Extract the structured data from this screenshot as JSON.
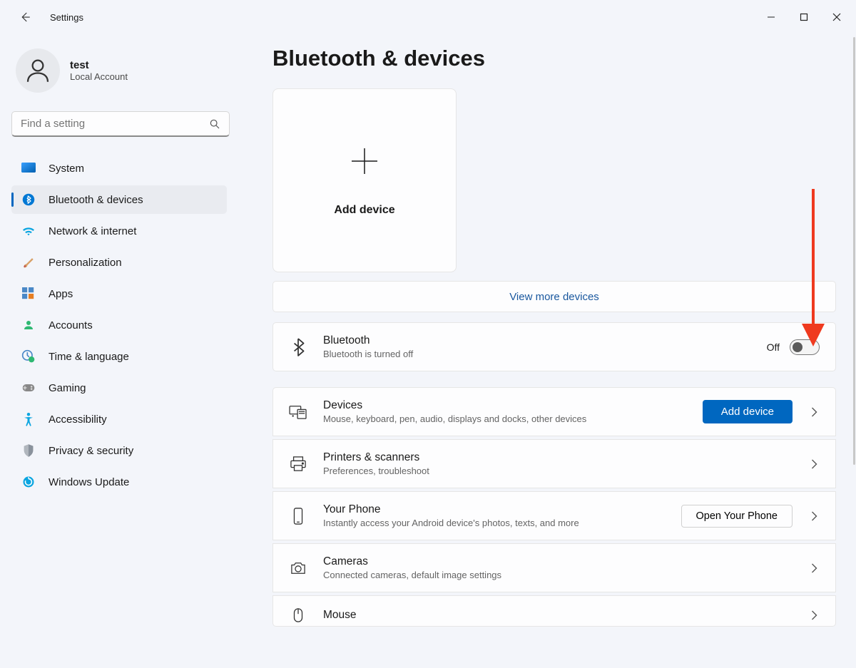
{
  "window": {
    "title": "Settings"
  },
  "user": {
    "name": "test",
    "subtitle": "Local Account"
  },
  "search": {
    "placeholder": "Find a setting"
  },
  "nav": {
    "items": [
      {
        "label": "System"
      },
      {
        "label": "Bluetooth & devices"
      },
      {
        "label": "Network & internet"
      },
      {
        "label": "Personalization"
      },
      {
        "label": "Apps"
      },
      {
        "label": "Accounts"
      },
      {
        "label": "Time & language"
      },
      {
        "label": "Gaming"
      },
      {
        "label": "Accessibility"
      },
      {
        "label": "Privacy & security"
      },
      {
        "label": "Windows Update"
      }
    ],
    "selected_index": 1
  },
  "page": {
    "title": "Bluetooth & devices",
    "add_device_tile": "Add device",
    "view_more": "View more devices",
    "bluetooth": {
      "title": "Bluetooth",
      "subtitle": "Bluetooth is turned off",
      "toggle_label": "Off",
      "toggle_state": false
    },
    "devices": {
      "title": "Devices",
      "subtitle": "Mouse, keyboard, pen, audio, displays and docks, other devices",
      "button": "Add device"
    },
    "printers": {
      "title": "Printers & scanners",
      "subtitle": "Preferences, troubleshoot"
    },
    "phone": {
      "title": "Your Phone",
      "subtitle": "Instantly access your Android device's photos, texts, and more",
      "button": "Open Your Phone"
    },
    "cameras": {
      "title": "Cameras",
      "subtitle": "Connected cameras, default image settings"
    },
    "mouse": {
      "title": "Mouse"
    }
  },
  "colors": {
    "accent": "#0067c0"
  }
}
